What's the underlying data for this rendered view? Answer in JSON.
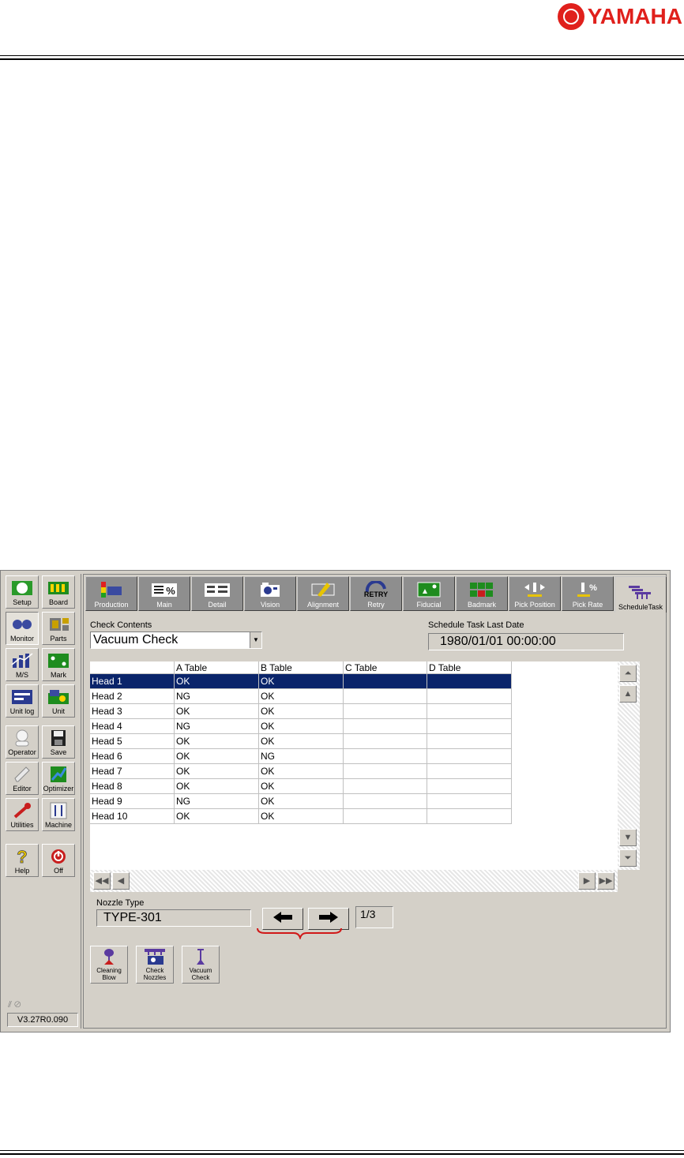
{
  "brand": "YAMAHA",
  "sidebar": {
    "buttons": [
      {
        "label": "Setup",
        "icon": "setup-icon"
      },
      {
        "label": "Board",
        "icon": "board-icon"
      },
      {
        "label": "Monitor",
        "icon": "monitor-icon"
      },
      {
        "label": "Parts",
        "icon": "parts-icon"
      },
      {
        "label": "M/S",
        "icon": "ms-icon"
      },
      {
        "label": "Mark",
        "icon": "mark-icon"
      },
      {
        "label": "Unit log",
        "icon": "unit-log-icon"
      },
      {
        "label": "Unit",
        "icon": "unit-icon"
      },
      {
        "label": "Operator",
        "icon": "operator-icon"
      },
      {
        "label": "Save",
        "icon": "save-icon"
      },
      {
        "label": "Editor",
        "icon": "editor-icon"
      },
      {
        "label": "Optimizer",
        "icon": "optimizer-icon"
      },
      {
        "label": "Utilities",
        "icon": "utilities-icon"
      },
      {
        "label": "Machine",
        "icon": "machine-icon"
      },
      {
        "label": "Help",
        "icon": "help-icon"
      },
      {
        "label": "Off",
        "icon": "power-icon"
      }
    ],
    "version": "V3.27R0.090"
  },
  "tabs": [
    {
      "label": "Production"
    },
    {
      "label": "Main"
    },
    {
      "label": "Detail"
    },
    {
      "label": "Vision"
    },
    {
      "label": "Alignment"
    },
    {
      "label": "Retry"
    },
    {
      "label": "Fiducial"
    },
    {
      "label": "Badmark"
    },
    {
      "label": "Pick Position"
    },
    {
      "label": "Pick Rate"
    },
    {
      "label": "ScheduleTask"
    }
  ],
  "check_contents": {
    "label": "Check Contents",
    "value": "Vacuum Check"
  },
  "last_date": {
    "label": "Schedule Task Last Date",
    "value": "1980/01/01 00:00:00"
  },
  "grid": {
    "columns": [
      "",
      "A Table",
      "B Table",
      "C Table",
      "D Table"
    ],
    "rows": [
      [
        "Head 1",
        "OK",
        "OK",
        "",
        ""
      ],
      [
        "Head 2",
        "NG",
        "OK",
        "",
        ""
      ],
      [
        "Head 3",
        "OK",
        "OK",
        "",
        ""
      ],
      [
        "Head 4",
        "NG",
        "OK",
        "",
        ""
      ],
      [
        "Head 5",
        "OK",
        "OK",
        "",
        ""
      ],
      [
        "Head 6",
        "OK",
        "NG",
        "",
        ""
      ],
      [
        "Head 7",
        "OK",
        "OK",
        "",
        ""
      ],
      [
        "Head 8",
        "OK",
        "OK",
        "",
        ""
      ],
      [
        "Head 9",
        "NG",
        "OK",
        "",
        ""
      ],
      [
        "Head 10",
        "OK",
        "OK",
        "",
        ""
      ]
    ],
    "selected_row": 0
  },
  "nozzle": {
    "label": "Nozzle Type",
    "value": "TYPE-301",
    "page": "1/3"
  },
  "actions": [
    {
      "label": "Cleaning Blow",
      "icon": "cleaning-blow-icon"
    },
    {
      "label": "Check Nozzles",
      "icon": "check-nozzles-icon"
    },
    {
      "label": "Vacuum Check",
      "icon": "vacuum-check-icon"
    }
  ],
  "colors": {
    "brand": "#e0201c",
    "selection": "#0a246a",
    "window": "#d4d0c8",
    "tab_inactive": "#8e8e8e"
  }
}
